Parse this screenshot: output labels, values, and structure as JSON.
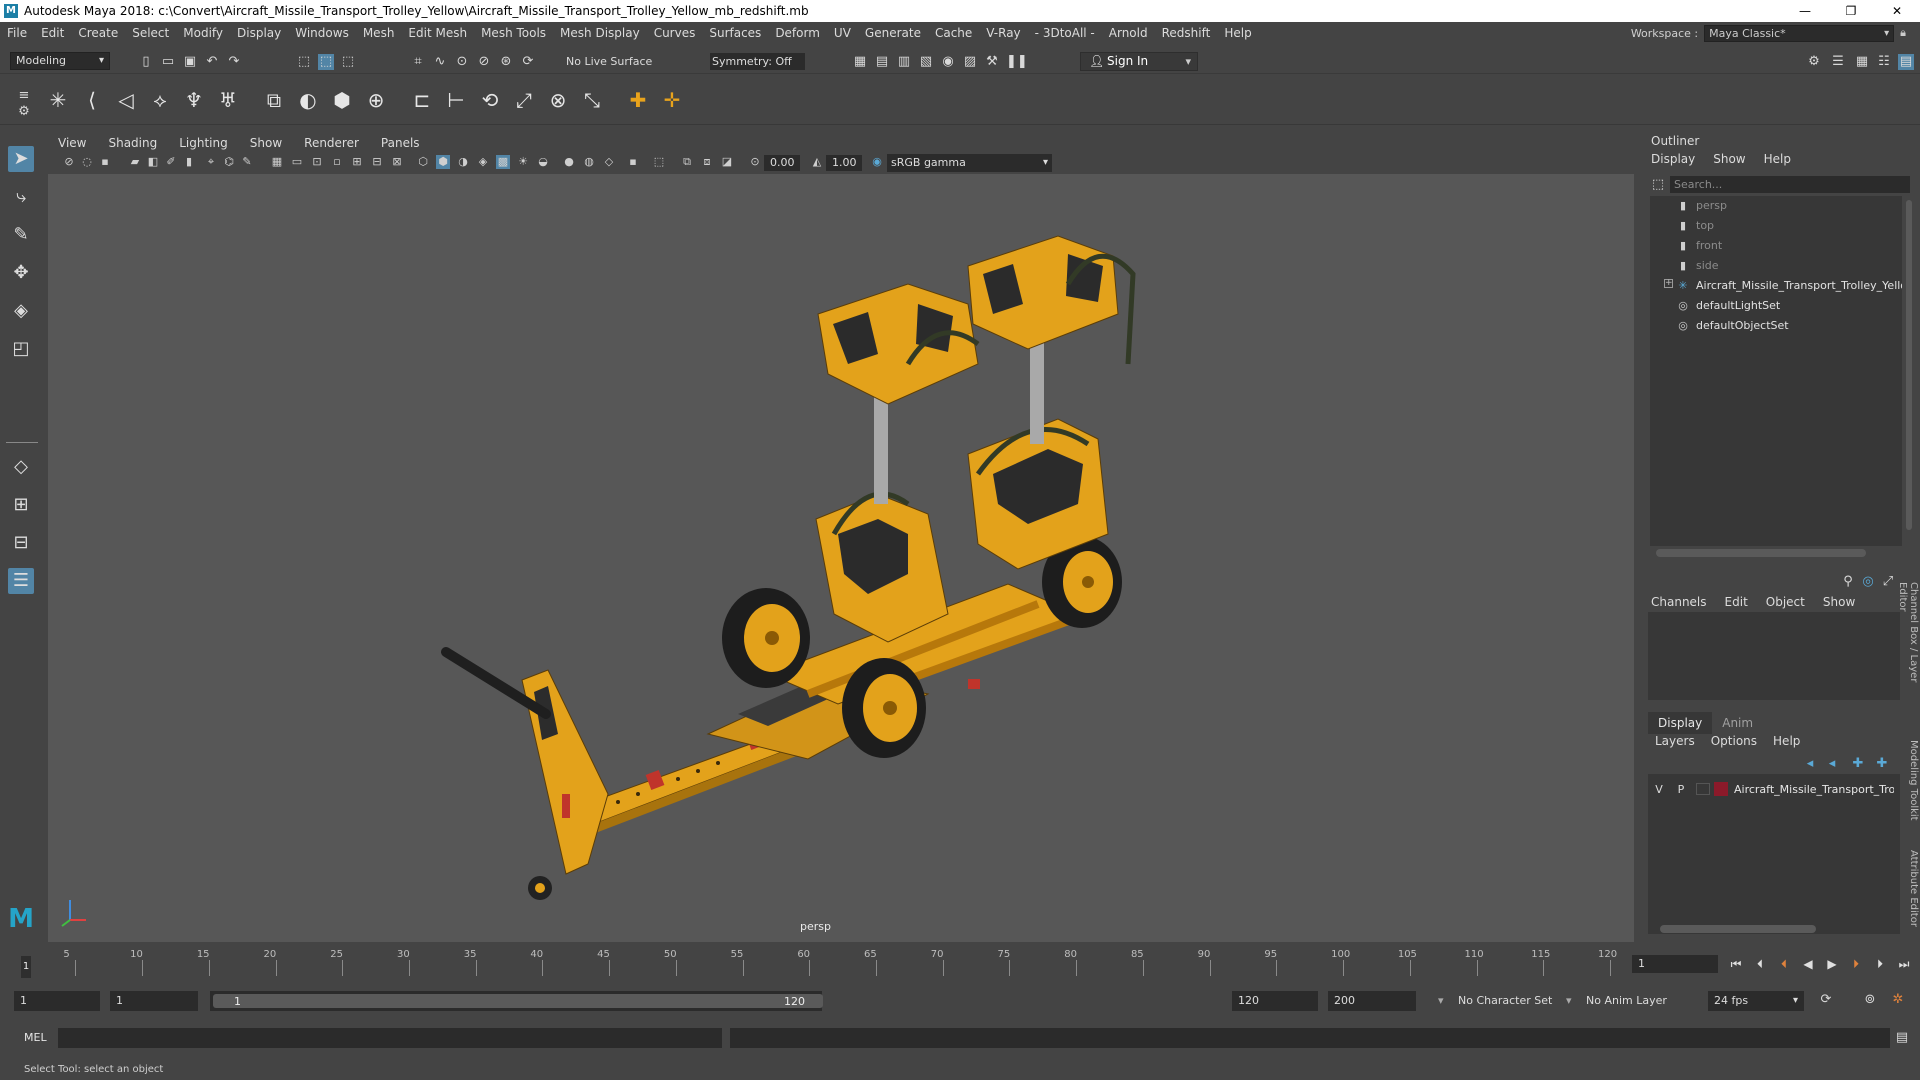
{
  "titlebar": {
    "title": "Autodesk Maya 2018: c:\\Convert\\Aircraft_Missile_Transport_Trolley_Yellow\\Aircraft_Missile_Transport_Trolley_Yellow_mb_redshift.mb",
    "minimize": "—",
    "maximize": "❐",
    "close": "✕"
  },
  "menubar": {
    "items": [
      "File",
      "Edit",
      "Create",
      "Select",
      "Modify",
      "Display",
      "Windows",
      "Mesh",
      "Edit Mesh",
      "Mesh Tools",
      "Mesh Display",
      "Curves",
      "Surfaces",
      "Deform",
      "UV",
      "Generate",
      "Cache",
      "V-Ray",
      "- 3DtoAll -",
      "Arnold",
      "Redshift",
      "Help"
    ],
    "workspace_label": "Workspace :",
    "workspace_value": "Maya Classic*"
  },
  "statusline": {
    "mode": "Modeling",
    "live_surface": "No Live Surface",
    "symmetry": "Symmetry: Off",
    "sign_in": "Sign In"
  },
  "viewport": {
    "menu": [
      "View",
      "Shading",
      "Lighting",
      "Show",
      "Renderer",
      "Panels"
    ],
    "exposure": "0.00",
    "gamma_value": "1.00",
    "color_space": "sRGB gamma",
    "camera_label": "persp"
  },
  "outliner": {
    "title": "Outliner",
    "menu": [
      "Display",
      "Show",
      "Help"
    ],
    "search_placeholder": "Search...",
    "items": [
      {
        "label": "persp",
        "icon": "camera-icon"
      },
      {
        "label": "top",
        "icon": "camera-icon"
      },
      {
        "label": "front",
        "icon": "camera-icon"
      },
      {
        "label": "side",
        "icon": "camera-icon"
      },
      {
        "label": "Aircraft_Missile_Transport_Trolley_Yellow",
        "icon": "group-icon"
      },
      {
        "label": "defaultLightSet",
        "icon": "set-icon"
      },
      {
        "label": "defaultObjectSet",
        "icon": "set-icon"
      }
    ]
  },
  "channelbox": {
    "menu": [
      "Channels",
      "Edit",
      "Object",
      "Show"
    ]
  },
  "layers": {
    "tabs": [
      "Display",
      "Anim"
    ],
    "menu": [
      "Layers",
      "Options",
      "Help"
    ],
    "row": {
      "v": "V",
      "p": "P",
      "name": "Aircraft_Missile_Transport_Troll",
      "color": "#8c1a2a"
    }
  },
  "side_tabs": [
    "Channel Box / Layer Editor",
    "Modeling Toolkit",
    "Attribute Editor"
  ],
  "timeslider": {
    "ticks": [
      "5",
      "10",
      "15",
      "20",
      "25",
      "30",
      "35",
      "40",
      "45",
      "50",
      "55",
      "60",
      "65",
      "70",
      "75",
      "80",
      "85",
      "90",
      "95",
      "100",
      "105",
      "110",
      "115",
      "120"
    ],
    "current_frame": "1",
    "frame_field": "1"
  },
  "range": {
    "start": "1",
    "playback_start": "1",
    "range_start_label": "1",
    "range_end_label": "120",
    "playback_end": "120",
    "end": "200",
    "character_set": "No Character Set",
    "anim_layer": "No Anim Layer",
    "fps": "24 fps"
  },
  "cmdline": {
    "label": "MEL"
  },
  "helpline": {
    "text": "Select Tool: select an object"
  }
}
